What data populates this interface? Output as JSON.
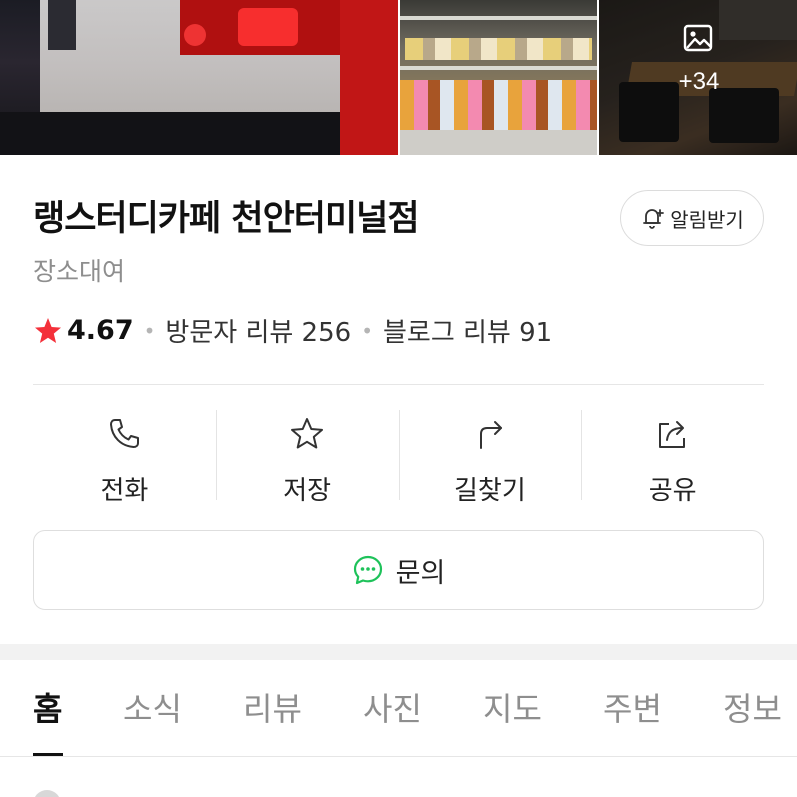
{
  "photos": {
    "more_count": "+34"
  },
  "place": {
    "name": "랭스터디카페 천안터미널점",
    "category": "장소대여",
    "rating": "4.67",
    "visitor_reviews": "방문자 리뷰 256",
    "blog_reviews": "블로그 리뷰 91",
    "notify_label": "알림받기"
  },
  "actions": [
    {
      "label": "전화",
      "icon": "phone-icon"
    },
    {
      "label": "저장",
      "icon": "star-outline-icon"
    },
    {
      "label": "길찾기",
      "icon": "directions-icon"
    },
    {
      "label": "공유",
      "icon": "share-icon"
    }
  ],
  "inquiry": {
    "label": "문의",
    "icon": "chat-bubble-icon"
  },
  "tabs": [
    {
      "label": "홈",
      "active": true
    },
    {
      "label": "소식"
    },
    {
      "label": "리뷰"
    },
    {
      "label": "사진"
    },
    {
      "label": "지도"
    },
    {
      "label": "주변"
    },
    {
      "label": "정보"
    }
  ],
  "colors": {
    "star": "#f4303a",
    "inquiry_icon": "#1ec25a",
    "text_primary": "#111111",
    "text_muted": "#8e8e8e"
  }
}
